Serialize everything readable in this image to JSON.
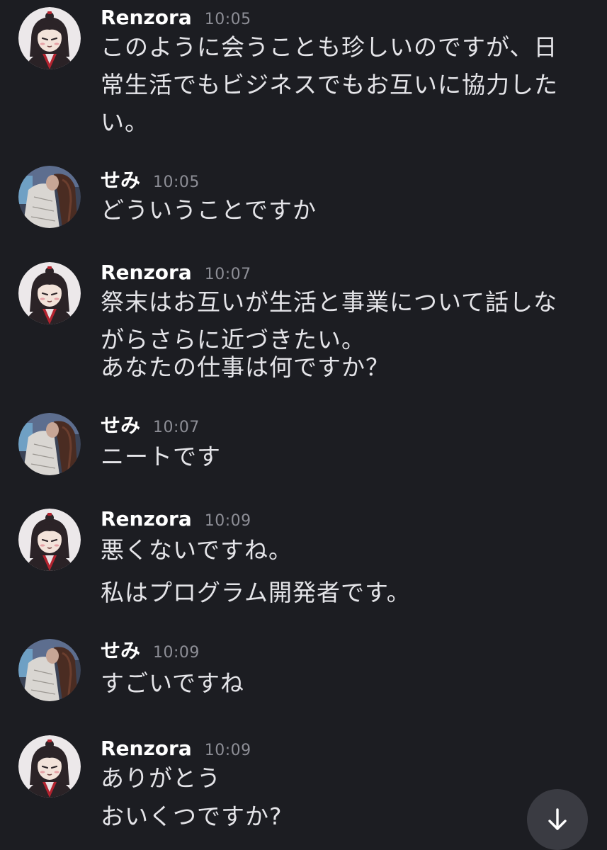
{
  "messages": [
    {
      "author": "Renzora",
      "time": "10:05",
      "lines": [
        "このように会うことも珍しいのですが、日",
        "常生活でもビジネスでもお互いに協力した",
        "い。"
      ]
    },
    {
      "author": "せみ",
      "time": "10:05",
      "lines": [
        "どういうことですか"
      ]
    },
    {
      "author": "Renzora",
      "time": "10:07",
      "lines": [
        "祭末はお互いが生活と事業について話しな",
        "がらさらに近づきたい。",
        "あなたの仕事は何ですか？"
      ]
    },
    {
      "author": "せみ",
      "time": "10:07",
      "lines": [
        "ニートです"
      ]
    },
    {
      "author": "Renzora",
      "time": "10:09",
      "lines": [
        "悪くないですね。",
        "私はプログラム開発者です。"
      ]
    },
    {
      "author": "せみ",
      "time": "10:09",
      "lines": [
        "すごいですね"
      ]
    },
    {
      "author": "Renzora",
      "time": "10:09",
      "lines": [
        "ありがとう",
        "おいくつですか?"
      ]
    }
  ],
  "scroll_button": {
    "icon": "arrow-down-icon"
  }
}
